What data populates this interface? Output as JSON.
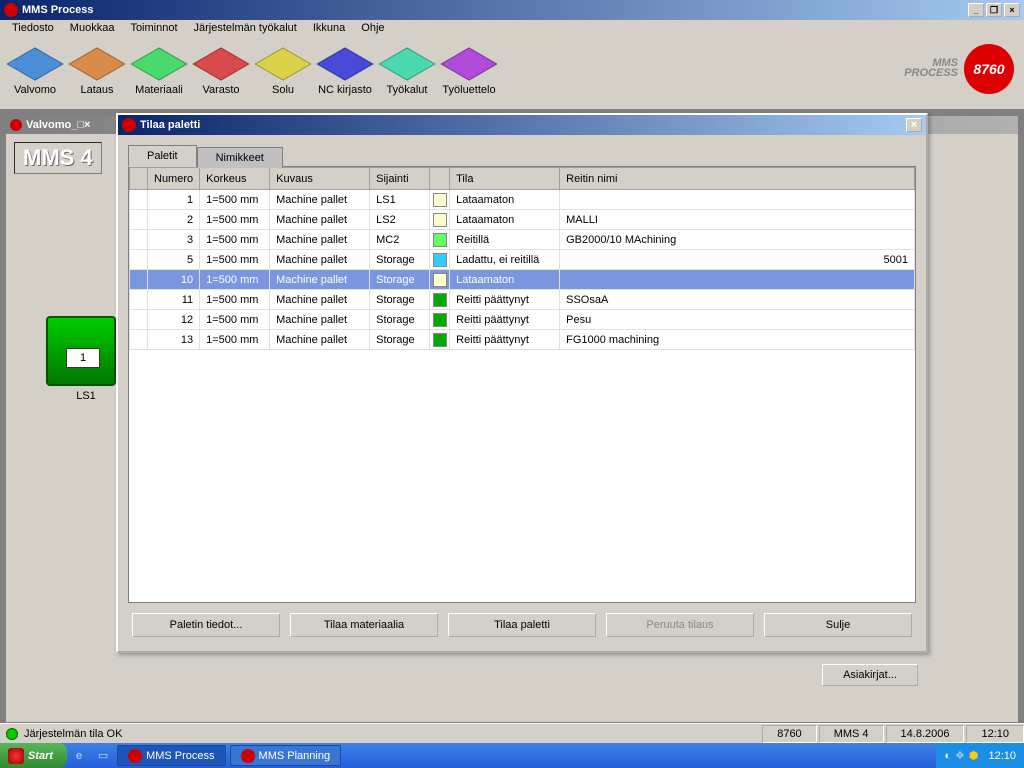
{
  "app": {
    "title": "MMS Process",
    "logo_line1": "MMS",
    "logo_line2": "PROCESS",
    "logo_badge": "8760"
  },
  "menu": [
    "Tiedosto",
    "Muokkaa",
    "Toiminnot",
    "Järjestelmän työkalut",
    "Ikkuna",
    "Ohje"
  ],
  "toolbar": [
    {
      "label": "Valvomo"
    },
    {
      "label": "Lataus"
    },
    {
      "label": "Materiaali"
    },
    {
      "label": "Varasto"
    },
    {
      "label": "Solu"
    },
    {
      "label": "NC kirjasto"
    },
    {
      "label": "Työkalut"
    },
    {
      "label": "Työluettelo"
    }
  ],
  "mdi_child": {
    "title": "Valvomo",
    "heading": "MMS 4",
    "station": {
      "slot": "1",
      "label": "LS1"
    },
    "side_button": "Asiakirjat..."
  },
  "modal": {
    "title": "Tilaa paletti",
    "tabs": [
      "Paletit",
      "Nimikkeet"
    ],
    "columns": [
      "",
      "Numero",
      "Korkeus",
      "Kuvaus",
      "Sijainti",
      "",
      "Tila",
      "Reitin nimi"
    ],
    "rows": [
      {
        "num": "1",
        "korkeus": "1=500 mm",
        "kuvaus": "Machine pallet",
        "sijainti": "LS1",
        "color": "#ffffcc",
        "tila": "Lataamaton",
        "reitti": ""
      },
      {
        "num": "2",
        "korkeus": "1=500 mm",
        "kuvaus": "Machine pallet",
        "sijainti": "LS2",
        "color": "#ffffcc",
        "tila": "Lataamaton",
        "reitti": "MALLI"
      },
      {
        "num": "3",
        "korkeus": "1=500 mm",
        "kuvaus": "Machine pallet",
        "sijainti": "MC2",
        "color": "#66ff66",
        "tila": "Reitillä",
        "reitti": "GB2000/10 MAchining"
      },
      {
        "num": "5",
        "korkeus": "1=500 mm",
        "kuvaus": "Machine pallet",
        "sijainti": "Storage",
        "color": "#33ccff",
        "tila": "Ladattu, ei reitillä",
        "reitti": "5001",
        "align_right": true
      },
      {
        "num": "10",
        "korkeus": "1=500 mm",
        "kuvaus": "Machine pallet",
        "sijainti": "Storage",
        "color": "#ffffcc",
        "tila": "Lataamaton",
        "reitti": "",
        "selected": true
      },
      {
        "num": "11",
        "korkeus": "1=500 mm",
        "kuvaus": "Machine pallet",
        "sijainti": "Storage",
        "color": "#00aa00",
        "tila": "Reitti päättynyt",
        "reitti": "SSOsaA"
      },
      {
        "num": "12",
        "korkeus": "1=500 mm",
        "kuvaus": "Machine pallet",
        "sijainti": "Storage",
        "color": "#00aa00",
        "tila": "Reitti päättynyt",
        "reitti": "Pesu"
      },
      {
        "num": "13",
        "korkeus": "1=500 mm",
        "kuvaus": "Machine pallet",
        "sijainti": "Storage",
        "color": "#00aa00",
        "tila": "Reitti päättynyt",
        "reitti": "FG1000 machining"
      }
    ],
    "buttons": {
      "details": "Paletin tiedot...",
      "order_material": "Tilaa materiaalia",
      "order_pallet": "Tilaa paletti",
      "cancel_order": "Peruuta tilaus",
      "close": "Sulje"
    }
  },
  "statusbar": {
    "text": "Järjestelmän tila OK",
    "panes": [
      "8760",
      "MMS 4",
      "14.8.2006",
      "12:10"
    ]
  },
  "taskbar": {
    "start": "Start",
    "apps": [
      "MMS Process",
      "MMS Planning"
    ],
    "clock": "12:10"
  }
}
